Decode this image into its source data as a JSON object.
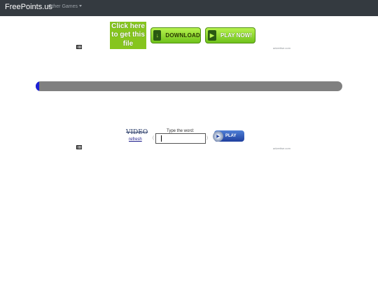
{
  "navbar": {
    "brand": "FreePoints.us",
    "dropdown_label": "Other Games"
  },
  "ad_top": {
    "click_here": "Click here to get this file",
    "download_label": "DOWNLOAD",
    "play_now_label": "PLAY NOW!",
    "ad_link": "advertise.com"
  },
  "progress": {
    "fraction": 0.009
  },
  "captcha": {
    "word": "VIDEO",
    "refresh_label": "refresh",
    "type_label": "Type the word:",
    "input_value": "",
    "play_label": "PLAY",
    "ad_link": "advertise.com"
  },
  "colors": {
    "navbar_bg": "#343a40",
    "progress_fill": "#1c1fd6",
    "progress_track": "#808080",
    "ad_green": "#86c51e"
  },
  "icons": [
    "caret-down-icon",
    "download-arrow-icon",
    "play-arrow-icon",
    "flag-icon",
    "disc-icon"
  ]
}
